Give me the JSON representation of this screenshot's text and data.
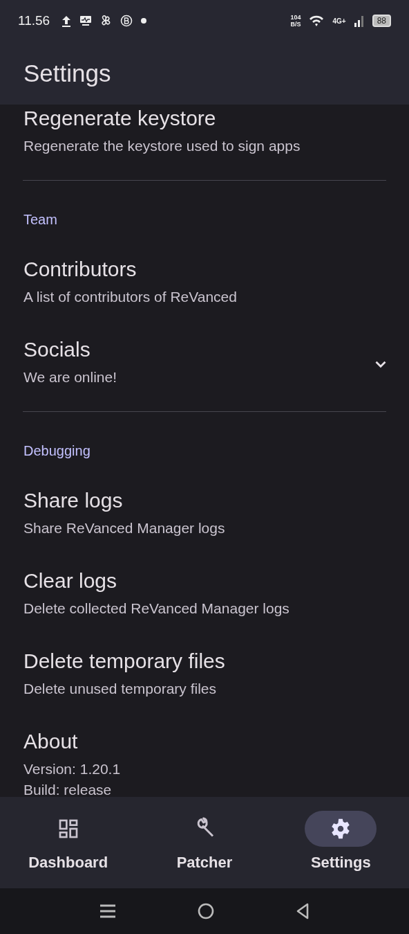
{
  "status_bar": {
    "time": "11.56",
    "net_speed": "104",
    "net_unit": "B/S",
    "network": "4G+",
    "battery": "88"
  },
  "header": {
    "title": "Settings"
  },
  "sections": [
    {
      "items": [
        {
          "kind": "plain",
          "title": "Regenerate keystore",
          "lines": [
            "Regenerate the keystore used to sign apps"
          ]
        }
      ]
    },
    {
      "heading": "Team",
      "items": [
        {
          "kind": "plain",
          "title": "Contributors",
          "lines": [
            "A list of contributors of ReVanced"
          ]
        },
        {
          "kind": "expandable",
          "title": "Socials",
          "lines": [
            "We are online!"
          ],
          "expanded": false
        }
      ]
    },
    {
      "heading": "Debugging",
      "items": [
        {
          "kind": "plain",
          "title": "Share logs",
          "lines": [
            "Share ReVanced Manager logs"
          ]
        },
        {
          "kind": "plain",
          "title": "Clear logs",
          "lines": [
            "Delete collected ReVanced Manager logs"
          ]
        },
        {
          "kind": "plain",
          "title": "Delete temporary files",
          "lines": [
            "Delete unused temporary files"
          ]
        },
        {
          "kind": "plain",
          "title": "About",
          "lines": [
            "Version: 1.20.1",
            "Build: release"
          ]
        }
      ]
    }
  ],
  "nav": [
    {
      "kind": "dashboard",
      "label": "Dashboard",
      "selected": false
    },
    {
      "kind": "patcher",
      "label": "Patcher",
      "selected": false
    },
    {
      "kind": "settings",
      "label": "Settings",
      "selected": true
    }
  ]
}
